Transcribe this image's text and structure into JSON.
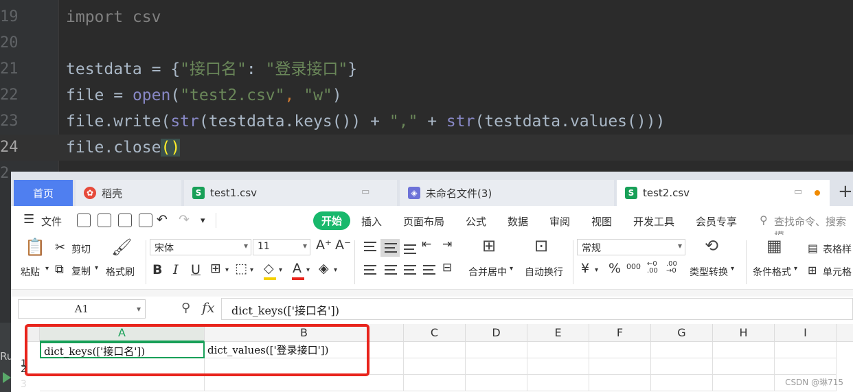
{
  "editor": {
    "lines": [
      {
        "num": "19",
        "parts": [
          {
            "t": "import csv",
            "c": "gray"
          }
        ]
      },
      {
        "num": "20",
        "parts": []
      },
      {
        "num": "21",
        "parts": [
          {
            "t": "testdata = {",
            "c": ""
          },
          {
            "t": "\"接口名\"",
            "c": "str"
          },
          {
            "t": ": ",
            "c": ""
          },
          {
            "t": "\"登录接口\"",
            "c": "str"
          },
          {
            "t": "}",
            "c": ""
          }
        ]
      },
      {
        "num": "22",
        "parts": [
          {
            "t": "file = ",
            "c": ""
          },
          {
            "t": "open",
            "c": "bi"
          },
          {
            "t": "(",
            "c": ""
          },
          {
            "t": "\"test2.csv\"",
            "c": "str"
          },
          {
            "t": ", ",
            "c": "kw"
          },
          {
            "t": "\"w\"",
            "c": "str"
          },
          {
            "t": ")",
            "c": ""
          }
        ]
      },
      {
        "num": "23",
        "parts": [
          {
            "t": "file.write(",
            "c": ""
          },
          {
            "t": "str",
            "c": "bi"
          },
          {
            "t": "(testdata.keys()) + ",
            "c": ""
          },
          {
            "t": "\",\"",
            "c": "str"
          },
          {
            "t": " + ",
            "c": ""
          },
          {
            "t": "str",
            "c": "bi"
          },
          {
            "t": "(testdata.values()))",
            "c": ""
          }
        ]
      },
      {
        "num": "24",
        "parts": [
          {
            "t": "file.close",
            "c": ""
          },
          {
            "t": "()",
            "c": "brk"
          }
        ],
        "current": true
      },
      {
        "num": "2",
        "parts": []
      }
    ],
    "left_panel_label": "Ru"
  },
  "sheet": {
    "tabs": {
      "home": "首页",
      "t1": "稻壳",
      "t2": "test1.csv",
      "t3": "未命名文件(3)",
      "t4": "test2.csv",
      "plus": "+"
    },
    "menu": {
      "file": "文件",
      "kaishi": "开始",
      "insert": "插入",
      "layout": "页面布局",
      "formula": "公式",
      "data": "数据",
      "review": "审阅",
      "view": "视图",
      "dev": "开发工具",
      "member": "会员专享",
      "search": "查找命令、搜索模"
    },
    "ribbon": {
      "paste": "粘贴",
      "cut": "剪切",
      "copy": "复制",
      "format_painter": "格式刷",
      "font": "宋体",
      "size": "11",
      "merge": "合并居中",
      "wrap": "自动换行",
      "number_format": "常规",
      "convert": "类型转换",
      "cond_format": "条件格式",
      "table_style": "表格样",
      "cell_style": "单元格"
    },
    "formula_bar": {
      "name_box": "A1",
      "fx": "fx",
      "content": "dict_keys(['接口名'])"
    },
    "columns": [
      "A",
      "B",
      "C",
      "D",
      "E",
      "F",
      "G",
      "H",
      "I"
    ],
    "rows": [
      "1",
      "2",
      "3"
    ],
    "cells": {
      "A1": "dict_keys(['接口名'])",
      "B1": "dict_values(['登录接口'])"
    }
  },
  "watermark": "CSDN @琳715"
}
